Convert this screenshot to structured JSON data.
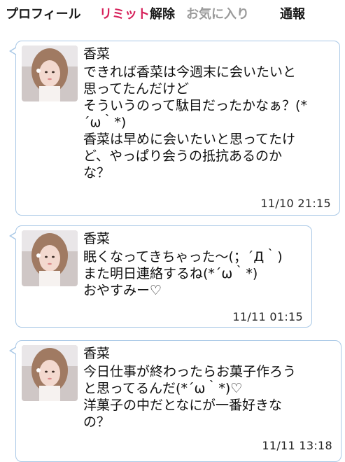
{
  "header": {
    "profile_label": "プロフィール",
    "limit_label": "リミット",
    "unlock_label": "解除",
    "favorite_label": "お気に入り",
    "report_label": "通報"
  },
  "colors": {
    "limit_accent": "#d6205a",
    "bubble_border": "#a9c8e6",
    "favorite_gray": "#9a9a9a"
  },
  "messages": [
    {
      "sender": "香菜",
      "text": "できれば香菜は今週末に会いたいと\n思ってたんだけど\nそういうのって駄目だったかなぁ？(*\n´ω｀*)\n香菜は早めに会いたいと思ってたけ\nど、やっぱり会うの抵抗あるのか\nな？",
      "time": "11/10 21:15"
    },
    {
      "sender": "香菜",
      "text": "眠くなってきちゃった〜(；´Д｀)\nまた明日連絡するね(*´ω｀*)\nおやすみー♡",
      "time": "11/11 01:15"
    },
    {
      "sender": "香菜",
      "text": "今日仕事が終わったらお菓子作ろう\nと思ってるんだ(*´ω｀*)♡\n洋菓子の中だとなにが一番好きな\nの？",
      "time": "11/11 13:18"
    }
  ]
}
